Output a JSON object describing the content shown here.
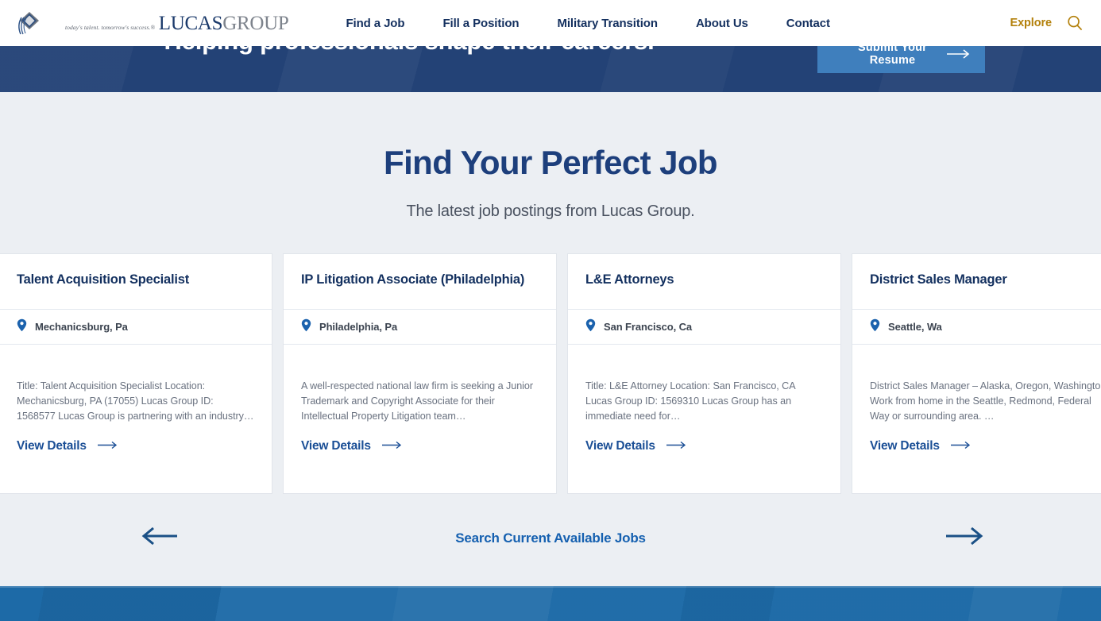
{
  "header": {
    "logo": {
      "tagline": "today's talent. tomorrow's success.®",
      "word_dark": "LUCAS",
      "word_gray": "GROUP"
    },
    "nav_items": [
      {
        "label": "Find a Job"
      },
      {
        "label": "Fill a Position"
      },
      {
        "label": "Military Transition"
      },
      {
        "label": "About Us"
      },
      {
        "label": "Contact"
      }
    ],
    "explore_label": "Explore",
    "search_icon": "search-icon",
    "accent_gold": "#b3800a",
    "nav_navy": "#14305f"
  },
  "hero": {
    "headline": "Helping professionals shape their careers.",
    "cta_label": "Submit Your Resume",
    "cta_arrow_icon": "arrow-right-icon",
    "band_color": "#234276",
    "cta_color": "#3f7fbd"
  },
  "section": {
    "title": "Find Your Perfect Job",
    "subtitle": "The latest job postings from Lucas Group.",
    "title_color": "#1d3f7c"
  },
  "jobs": [
    {
      "title": "Talent Acquisition Specialist",
      "location_icon": "map-pin-icon",
      "location": "Mechanicsburg, Pa",
      "excerpt": "Title: Talent Acquisition Specialist Location: Mechanicsburg, PA (17055) Lucas Group ID: 1568577   Lucas Group is partnering with an industry…",
      "cta_label": "View Details",
      "cta_icon": "arrow-right-icon"
    },
    {
      "title": "IP Litigation Associate (Philadelphia)",
      "location_icon": "map-pin-icon",
      "location": "Philadelphia, Pa",
      "excerpt": "A well-respected national law firm is seeking a Junior Trademark and Copyright Associate for their Intellectual Property Litigation team…",
      "cta_label": "View Details",
      "cta_icon": "arrow-right-icon"
    },
    {
      "title": "L&E Attorneys",
      "location_icon": "map-pin-icon",
      "location": "San Francisco, Ca",
      "excerpt": "Title: L&E Attorney Location: San Francisco, CA Lucas Group ID: 1569310   Lucas Group has an immediate need for…",
      "cta_label": "View Details",
      "cta_icon": "arrow-right-icon"
    },
    {
      "title": "District Sales Manager",
      "location_icon": "map-pin-icon",
      "location": "Seattle, Wa",
      "excerpt": "District Sales Manager – Alaska, Oregon, Washington   Work from home in the Seattle, Redmond, Federal Way or surrounding area. …",
      "cta_label": "View Details",
      "cta_icon": "arrow-right-icon"
    }
  ],
  "carousel": {
    "prev_icon": "arrow-left-icon",
    "next_icon": "arrow-right-icon",
    "search_link_label": "Search Current Available Jobs",
    "link_color": "#1560b0"
  },
  "footer": {
    "band_color": "#1d6aa7"
  }
}
